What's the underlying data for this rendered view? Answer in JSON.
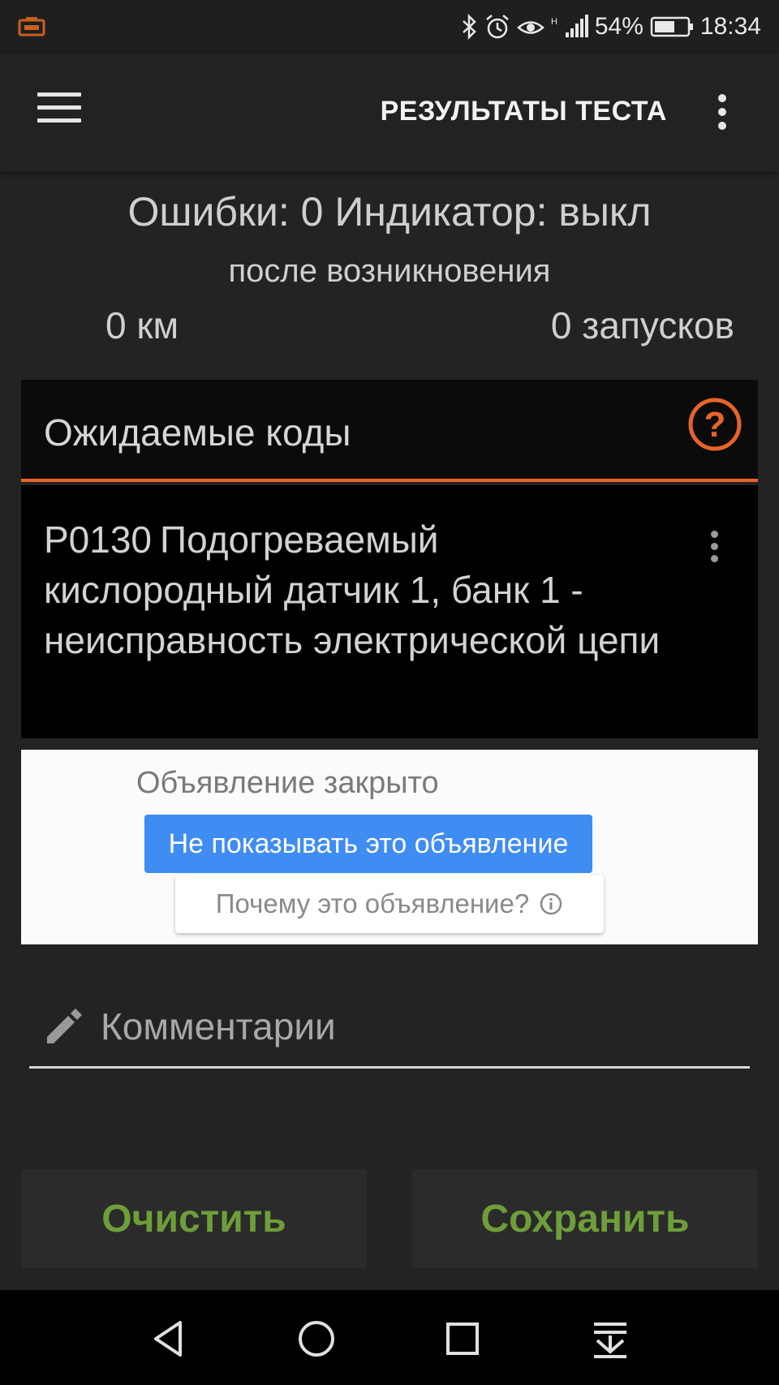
{
  "status_bar": {
    "battery": "54%",
    "time": "18:34"
  },
  "app_bar": {
    "title": "РЕЗУЛЬТАТЫ ТЕСТА"
  },
  "summary": {
    "errors_indicator": "Ошибки: 0 Индикатор: выкл",
    "since": "после возникновения",
    "distance": "0 км",
    "starts": "0 запусков"
  },
  "pending_codes": {
    "title": "Ожидаемые коды",
    "items": [
      {
        "code": "P0130",
        "description": "Подогреваемый кислородный датчик 1, банк 1 - неисправность электрической цепи"
      }
    ]
  },
  "ad": {
    "closed_text": "Объявление закрыто",
    "hide_label": "Не показывать это объявление",
    "why_label": "Почему это объявление?"
  },
  "comments": {
    "placeholder": "Комментарии"
  },
  "actions": {
    "clear_label": "Очистить",
    "save_label": "Сохранить"
  },
  "colors": {
    "accent_orange": "#e8632a",
    "action_green": "#6e9e3a",
    "ad_blue": "#3f8cf2"
  }
}
